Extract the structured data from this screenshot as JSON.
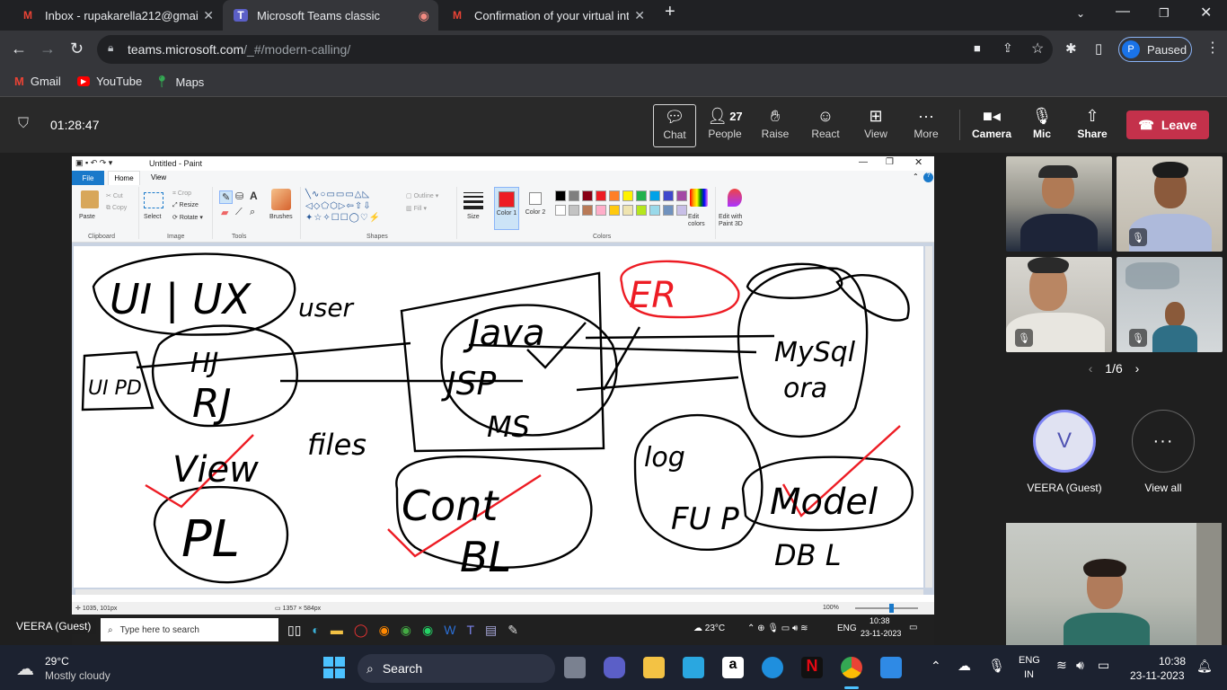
{
  "browser": {
    "tabs": [
      {
        "title": "Inbox - rupakarella212@gmail.co",
        "icon": "gmail-icon",
        "active": false
      },
      {
        "title": "Microsoft Teams classic",
        "icon": "teams-icon",
        "active": true
      },
      {
        "title": "Confirmation of your virtual inte",
        "icon": "gmail-icon",
        "active": false
      }
    ],
    "url_host": "teams.microsoft.com",
    "url_path": "/_#/modern-calling/",
    "profile_initial": "P",
    "profile_status": "Paused",
    "bookmarks": [
      {
        "label": "Gmail",
        "icon": "gmail-icon"
      },
      {
        "label": "YouTube",
        "icon": "youtube-icon"
      },
      {
        "label": "Maps",
        "icon": "maps-icon"
      }
    ]
  },
  "meeting": {
    "timer": "01:28:47",
    "controls": [
      {
        "label": "Chat",
        "icon": "chat-icon"
      },
      {
        "label": "People",
        "icon": "people-icon",
        "count": "27"
      },
      {
        "label": "Raise",
        "icon": "hand-icon"
      },
      {
        "label": "React",
        "icon": "smile-icon"
      },
      {
        "label": "View",
        "icon": "grid-icon"
      },
      {
        "label": "More",
        "icon": "ellipsis-icon"
      },
      {
        "label": "Camera",
        "icon": "camera-icon"
      },
      {
        "label": "Mic",
        "icon": "mic-off-icon"
      },
      {
        "label": "Share",
        "icon": "share-icon"
      }
    ],
    "leave_label": "Leave",
    "pager": "1/6",
    "avatar_initial": "V",
    "avatar_name": "VEERA (Guest)",
    "view_all_label": "View all",
    "presenter_tag": "VEERA (Guest)"
  },
  "paint": {
    "title": "Untitled - Paint",
    "menu": {
      "file": "File",
      "home": "Home",
      "view": "View"
    },
    "clipboard": {
      "paste": "Paste",
      "cut": "Cut",
      "copy": "Copy",
      "group": "Clipboard"
    },
    "image": {
      "select": "Select",
      "crop": "Crop",
      "resize": "Resize",
      "rotate": "Rotate",
      "group": "Image"
    },
    "tools_group": "Tools",
    "brushes": "Brushes",
    "shapes": {
      "outline": "Outline",
      "fill": "Fill",
      "group": "Shapes"
    },
    "size": "Size",
    "color1": "Color 1",
    "color2": "Color 2",
    "colors_group": "Colors",
    "edit_colors": "Edit colors",
    "edit_3d": "Edit with Paint 3D",
    "status_pos": "1035, 101px",
    "status_size": "1357 × 584px",
    "zoom": "100%",
    "drawing_text": {
      "ui_ux": "UI | UX",
      "user": "user",
      "er": "ER",
      "java": "Java",
      "mysql": "MySql",
      "ora": "ora",
      "jsp": "JSP",
      "ms": "MS",
      "hj": "HJ",
      "rj": "RJ",
      "ui_pd": "UI PD",
      "view": "View",
      "files": "files",
      "cont": "Cont",
      "bl": "BL",
      "pl": "PL",
      "log": "log",
      "model": "Model",
      "dbl": "DB L",
      "fup": "FU P"
    },
    "palette": [
      "#000000",
      "#7f7f7f",
      "#880015",
      "#ed1c24",
      "#ff7f27",
      "#fff200",
      "#22b14c",
      "#00a2e8",
      "#3f48cc",
      "#a349a4",
      "#ffffff",
      "#c3c3c3",
      "#b97a57",
      "#ffaec9",
      "#ffc90e",
      "#efe4b0",
      "#b5e61d",
      "#99d9ea",
      "#7092be",
      "#c8bfe7"
    ]
  },
  "remote_taskbar": {
    "search_placeholder": "Type here to search",
    "weather": "23°C",
    "lang": "ENG",
    "time": "10:38",
    "date": "23-11-2023"
  },
  "windows_taskbar": {
    "temp": "29°C",
    "weather": "Mostly cloudy",
    "search": "Search",
    "lang1": "ENG",
    "lang2": "IN",
    "time": "10:38",
    "date": "23-11-2023"
  }
}
